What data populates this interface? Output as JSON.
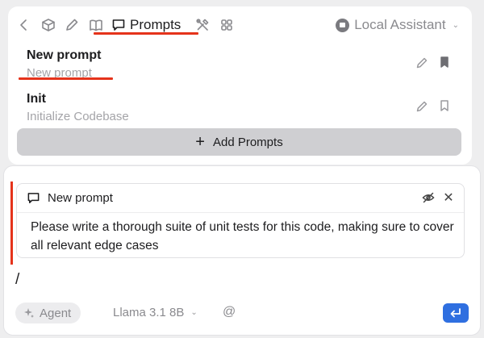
{
  "toolbar": {
    "active_tab_label": "Prompts",
    "assistant_label": "Local Assistant",
    "icons": [
      "back-icon",
      "cube-icon",
      "pencil-icon",
      "book-icon",
      "message-icon",
      "tools-icon",
      "grid-icon"
    ]
  },
  "prompts": [
    {
      "title": "New prompt",
      "subtitle": "New prompt",
      "bookmarked": true
    },
    {
      "title": "Init",
      "subtitle": "Initialize Codebase",
      "bookmarked": false
    }
  ],
  "add_button_label": "Add Prompts",
  "attachment": {
    "title": "New prompt",
    "body": "Please write a thorough suite of unit tests for this code, making sure to cover all relevant edge cases"
  },
  "input": {
    "value": "/"
  },
  "composer": {
    "mode_label": "Agent",
    "model_label": "Llama 3.1 8B",
    "mention_symbol": "@"
  },
  "colors": {
    "accent_red": "#e5331b",
    "send_blue": "#2f6fe0"
  }
}
